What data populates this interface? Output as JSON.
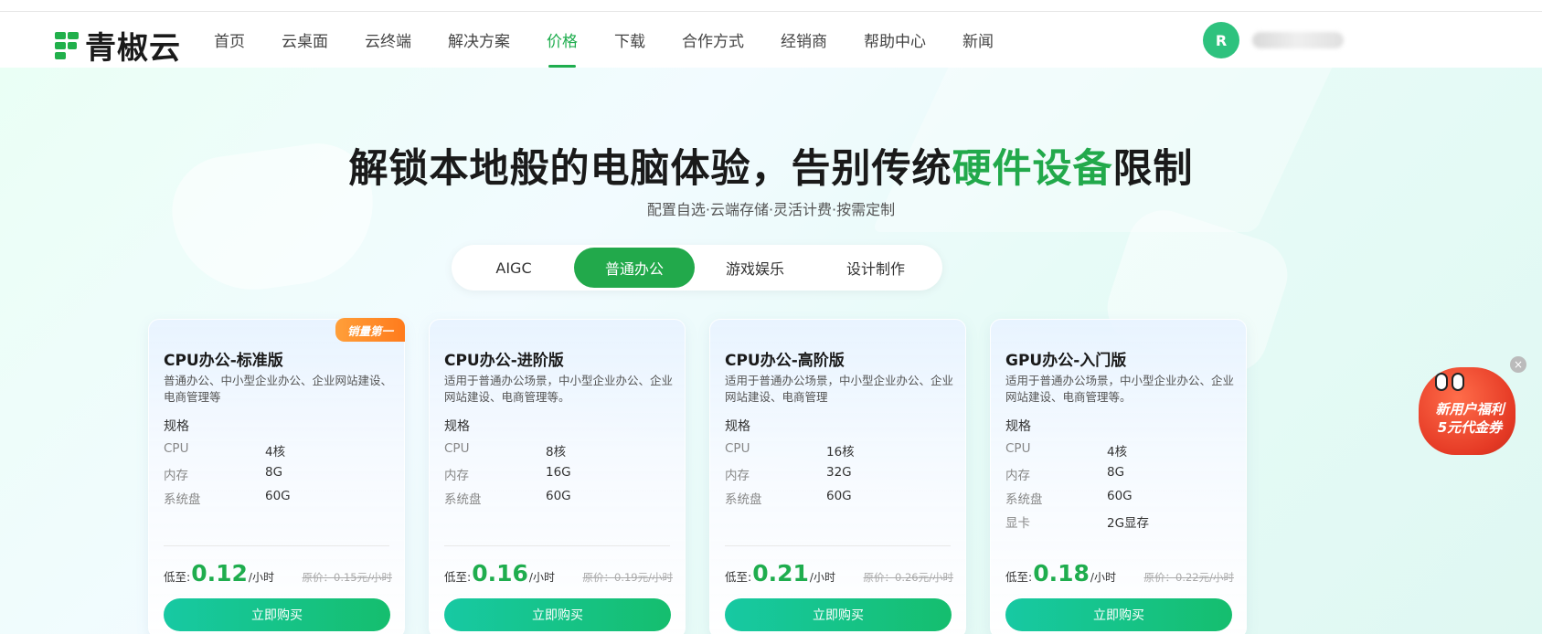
{
  "nav": {
    "logo_text": "青椒云",
    "items": [
      "首页",
      "云桌面",
      "云终端",
      "解决方案",
      "价格",
      "下载",
      "合作方式",
      "经销商",
      "帮助中心",
      "新闻"
    ],
    "active_index": 4,
    "user_initial": "R"
  },
  "hero": {
    "title_part1": "解锁本地般的电脑体验，告别传统",
    "title_highlight": "硬件设备",
    "title_part2": "限制",
    "subtitle": "配置自选·云端存储·灵活计费·按需定制"
  },
  "tabs": [
    "AIGC",
    "普通办公",
    "游戏娱乐",
    "设计制作"
  ],
  "active_tab": 1,
  "cards": [
    {
      "badge": "销量第一",
      "title": "CPU办公-标准版",
      "desc": "普通办公、中小型企业办公、企业网站建设、电商管理等",
      "spec_head": "规格",
      "specs": [
        [
          "CPU",
          "4核"
        ],
        [
          "内存",
          "8G"
        ],
        [
          "系统盘",
          "60G"
        ]
      ],
      "price_prefix": "低至:",
      "price": "0.12",
      "unit": "/小时",
      "orig": "原价：0.15元/小时",
      "buy": "立即购买"
    },
    {
      "title": "CPU办公-进阶版",
      "desc": "适用于普通办公场景，中小型企业办公、企业网站建设、电商管理等。",
      "spec_head": "规格",
      "specs": [
        [
          "CPU",
          "8核"
        ],
        [
          "内存",
          "16G"
        ],
        [
          "系统盘",
          "60G"
        ]
      ],
      "price_prefix": "低至:",
      "price": "0.16",
      "unit": "/小时",
      "orig": "原价：0.19元/小时",
      "buy": "立即购买"
    },
    {
      "title": "CPU办公-高阶版",
      "desc": "适用于普通办公场景，中小型企业办公、企业网站建设、电商管理",
      "spec_head": "规格",
      "specs": [
        [
          "CPU",
          "16核"
        ],
        [
          "内存",
          "32G"
        ],
        [
          "系统盘",
          "60G"
        ]
      ],
      "price_prefix": "低至:",
      "price": "0.21",
      "unit": "/小时",
      "orig": "原价：0.26元/小时",
      "buy": "立即购买"
    },
    {
      "title": "GPU办公-入门版",
      "desc": "适用于普通办公场景，中小型企业办公、企业网站建设、电商管理等。",
      "spec_head": "规格",
      "specs": [
        [
          "CPU",
          "4核"
        ],
        [
          "内存",
          "8G"
        ],
        [
          "系统盘",
          "60G"
        ],
        [
          "显卡",
          "2G显存"
        ]
      ],
      "price_prefix": "低至:",
      "price": "0.18",
      "unit": "/小时",
      "orig": "原价：0.22元/小时",
      "buy": "立即购买"
    }
  ],
  "promo": {
    "line1": "新用户福利",
    "line2": "5元代金券",
    "close": "×"
  },
  "colors": {
    "brand_green": "#22a94b",
    "price_green": "#1fad4e",
    "badge_orange": "#ff8a28"
  }
}
